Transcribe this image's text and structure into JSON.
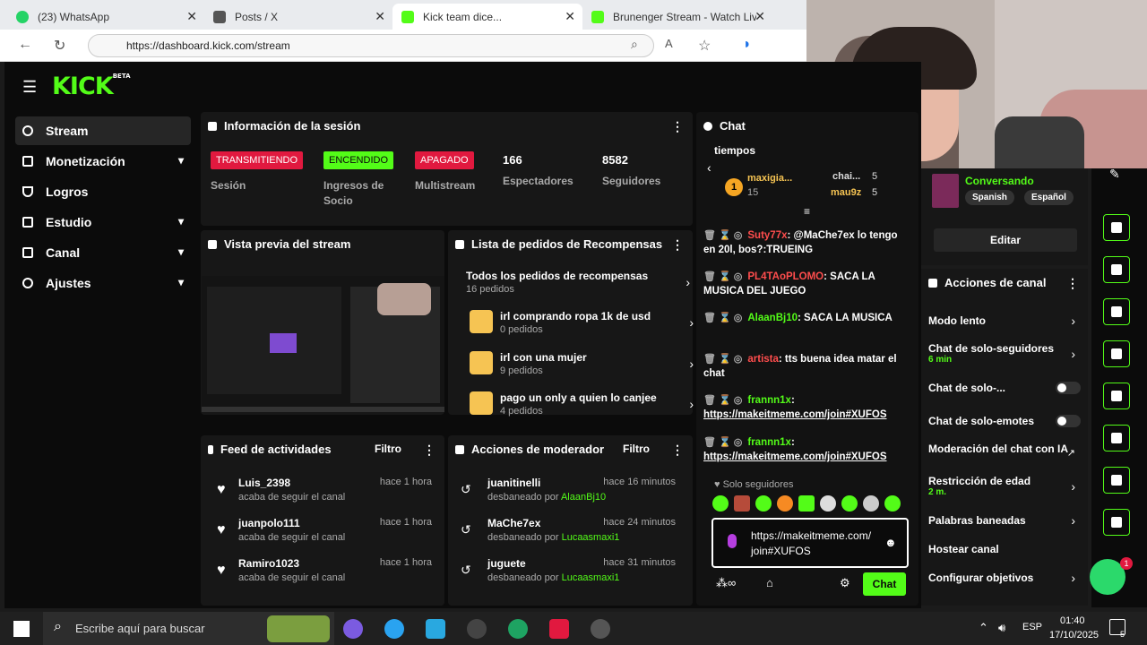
{
  "browser": {
    "tabs": [
      {
        "title": "(23) WhatsApp",
        "color": "#25d366"
      },
      {
        "title": "Posts / X",
        "color": "#000000"
      },
      {
        "title": "Kick team dice...",
        "color": "#53fc18"
      },
      {
        "title": "Brunenger Stream - Watch Live",
        "color": "#53fc18"
      }
    ],
    "url": "https://dashboard.kick.com/stream"
  },
  "kick": {
    "logo": "KICK",
    "logo_badge": "BETA",
    "sidebar": [
      {
        "label": "Stream",
        "icon": "broadcast-icon"
      },
      {
        "label": "Monetización",
        "icon": "money-icon"
      },
      {
        "label": "Logros",
        "icon": "trophy-icon"
      },
      {
        "label": "Estudio",
        "icon": "camera-icon"
      },
      {
        "label": "Canal",
        "icon": "channel-icon"
      },
      {
        "label": "Ajustes",
        "icon": "gear-icon"
      }
    ],
    "session": {
      "title": "Información de la sesión",
      "stats": [
        {
          "badge": "TRANSMITIENDO",
          "label": "Sesión"
        },
        {
          "badge": "ENCENDIDO",
          "label": "Ingresos de Socio"
        },
        {
          "badge": "APAGADO",
          "label": "Multistream"
        },
        {
          "value": "166",
          "label": "Espectadores"
        },
        {
          "value": "8582",
          "label": "Seguidores"
        }
      ]
    },
    "preview": {
      "title": "Vista previa del stream"
    },
    "rewards": {
      "title": "Lista de pedidos de Recompensas",
      "items": [
        {
          "title": "Todos los pedidos de recompensas",
          "sub": "16 pedidos"
        },
        {
          "title": "irl comprando ropa 1k de usd",
          "sub": "0 pedidos"
        },
        {
          "title": "irl con una mujer",
          "sub": "9 pedidos"
        },
        {
          "title": "pago un only a quien lo canjee",
          "sub": "4 pedidos"
        }
      ]
    },
    "feed": {
      "title": "Feed de actividades",
      "filter": "Filtro",
      "items": [
        {
          "name": "Luis_2398",
          "sub": "acaba de seguir el canal",
          "time": "hace 1 hora"
        },
        {
          "name": "juanpolo111",
          "sub": "acaba de seguir el canal",
          "time": "hace 1 hora"
        },
        {
          "name": "Ramiro1023",
          "sub": "acaba de seguir el canal",
          "time": "hace 1 hora"
        }
      ]
    },
    "mod": {
      "title": "Acciones de moderador",
      "filter": "Filtro",
      "items": [
        {
          "name": "juanitinelli",
          "prefix": "desbaneado por ",
          "by": "AlaanBj10",
          "time": "hace 16 minutos",
          "by_color": "#53fc18"
        },
        {
          "name": "MaChe7ex",
          "prefix": "desbaneado por ",
          "by": "Lucaasmaxi1",
          "time": "hace 24 minutos",
          "by_color": "#53fc18"
        },
        {
          "name": "juguete",
          "prefix": "desbaneado por ",
          "by": "Lucaasmaxi1",
          "time": "hace 31 minutos",
          "by_color": "#53fc18"
        }
      ]
    },
    "chat": {
      "title": "Chat",
      "pinned_text": "tiempos",
      "leaderboard": [
        {
          "name": "maxigia...",
          "count": "15",
          "rank": "1"
        },
        {
          "name": "chai...",
          "count": "5"
        },
        {
          "name": "mau9z",
          "count": "5"
        }
      ],
      "messages": [
        {
          "user": "Suty77x",
          "color": "#ff4d4d",
          "text": ": @MaChe7ex lo tengo en 20l, bos?:TRUEING"
        },
        {
          "user": "PL4TAoPLOMO",
          "color": "#ff4d4d",
          "text": ": SACA LA MUSICA DEL JUEGO"
        },
        {
          "user": "AlaanBj10",
          "color": "#53fc18",
          "text": ": SACA LA MUSICA"
        },
        {
          "user": "artista",
          "color": "#ff4d4d",
          "text": ": tts buena idea matar el chat"
        },
        {
          "user": "frannn1x",
          "color": "#53fc18",
          "text": ":",
          "link": "https://makeitmeme.com/join#XUFOS"
        },
        {
          "user": "frannn1x",
          "color": "#53fc18",
          "text": ":",
          "link": "https://makeitmeme.com/join#XUFOS"
        }
      ],
      "mode": "Solo seguidores",
      "input_value": "https://makeitmeme.com/join#XUFOS",
      "send_label": "Chat"
    },
    "channel": {
      "category": "Conversando",
      "tags": [
        "Spanish",
        "Español"
      ],
      "edit_label": "Editar"
    },
    "actions": {
      "title": "Acciones de canal",
      "items": [
        {
          "label": "Modo lento",
          "kind": "chevron"
        },
        {
          "label": "Chat de solo-seguidores",
          "sub": "6 min",
          "kind": "chevron"
        },
        {
          "label": "Chat de solo-...",
          "kind": "toggle"
        },
        {
          "label": "Chat de solo-emotes",
          "kind": "toggle"
        },
        {
          "label": "Moderación del chat con IA",
          "kind": "external"
        },
        {
          "label": "Restricción de edad",
          "sub": "2 m.",
          "kind": "chevron"
        },
        {
          "label": "Palabras baneadas",
          "kind": "chevron"
        },
        {
          "label": "Hostear canal",
          "kind": "none"
        },
        {
          "label": "Configurar objetivos",
          "kind": "chevron"
        }
      ]
    }
  },
  "taskbar": {
    "search_placeholder": "Escribe aquí para buscar",
    "lang": "ESP",
    "time": "01:40",
    "date": "17/10/2025",
    "notif_count": "5"
  }
}
